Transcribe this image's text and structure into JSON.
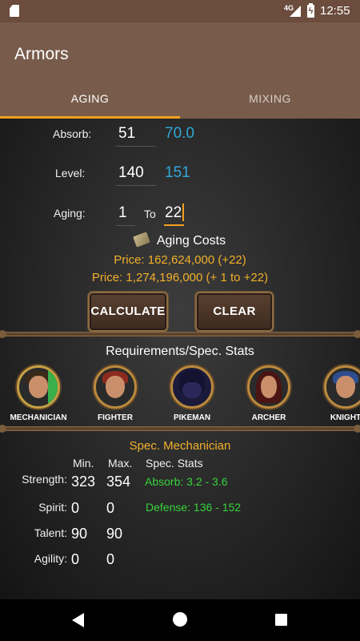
{
  "status_bar": {
    "time": "12:55",
    "network": "4G",
    "icons": [
      "sd-card-icon",
      "signal-icon",
      "battery-charging-icon"
    ]
  },
  "app_bar": {
    "title": "Armors"
  },
  "tabs": [
    {
      "label": "AGING",
      "active": true
    },
    {
      "label": "MIXING",
      "active": false
    }
  ],
  "stats": {
    "absorb": {
      "label": "Absorb:",
      "value": "51",
      "result": "70.0"
    },
    "level": {
      "label": "Level:",
      "value": "140",
      "result": "151"
    },
    "aging": {
      "label": "Aging:",
      "from": "1",
      "to_label": "To",
      "to": "22"
    }
  },
  "costs": {
    "title": "Aging Costs",
    "price_line": "Price: 162,624,000 (+22)",
    "price_total_line": "Price: 1,274,196,000 (+ 1 to +22)"
  },
  "buttons": {
    "calculate": "CALCULATE",
    "clear": "CLEAR"
  },
  "requirements": {
    "title": "Requirements/Spec. Stats",
    "classes": [
      {
        "name": "MECHANICIAN",
        "icon": "mechanician-avatar-icon"
      },
      {
        "name": "FIGHTER",
        "icon": "fighter-avatar-icon"
      },
      {
        "name": "PIKEMAN",
        "icon": "pikeman-avatar-icon"
      },
      {
        "name": "ARCHER",
        "icon": "archer-avatar-icon"
      },
      {
        "name": "KNIGHT",
        "icon": "knight-avatar-icon"
      }
    ]
  },
  "spec": {
    "title": "Spec. Mechanician",
    "headers": {
      "min": "Min.",
      "max": "Max.",
      "spec_stats": "Spec. Stats"
    },
    "rows": [
      {
        "label": "Strength:",
        "min": "323",
        "max": "354"
      },
      {
        "label": "Spirit:",
        "min": "0",
        "max": "0"
      },
      {
        "label": "Talent:",
        "min": "90",
        "max": "90"
      },
      {
        "label": "Agility:",
        "min": "0",
        "max": "0"
      }
    ],
    "spec_stats": [
      "Absorb: 3.2 - 3.6",
      "Defense: 136 - 152"
    ]
  },
  "colors": {
    "app_bar": "#785b4b",
    "accent": "#f3a01f",
    "price": "#f2b02b",
    "result_blue": "#2fa6d8",
    "spec_green": "#36d43a"
  }
}
